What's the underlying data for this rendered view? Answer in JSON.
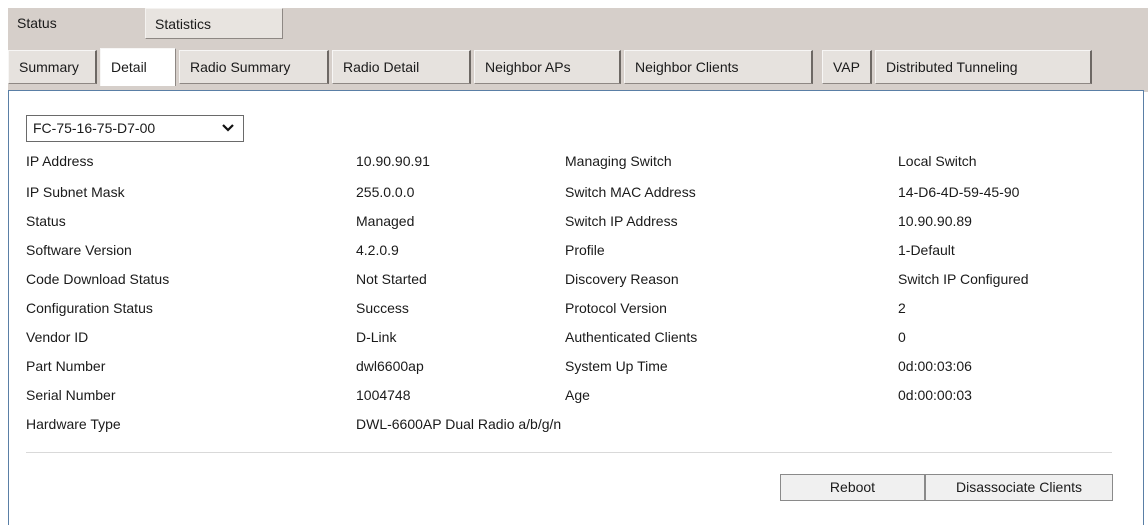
{
  "top_tabs": {
    "status": "Status",
    "statistics": "Statistics"
  },
  "sub_tabs": [
    "Summary",
    "Detail",
    "Radio Summary",
    "Radio Detail",
    "Neighbor APs",
    "Neighbor Clients",
    "VAP",
    "Distributed Tunneling"
  ],
  "ap_select": {
    "value": "FC-75-16-75-D7-00"
  },
  "details_left": [
    {
      "label": "IP Address",
      "value": "10.90.90.91"
    },
    {
      "label": "IP Subnet Mask",
      "value": "255.0.0.0"
    },
    {
      "label": "Status",
      "value": "Managed"
    },
    {
      "label": "Software Version",
      "value": "4.2.0.9"
    },
    {
      "label": "Code Download Status",
      "value": "Not Started"
    },
    {
      "label": "Configuration Status",
      "value": "Success"
    },
    {
      "label": "Vendor ID",
      "value": "D-Link"
    },
    {
      "label": "Part Number",
      "value": "dwl6600ap"
    },
    {
      "label": "Serial Number",
      "value": "1004748"
    },
    {
      "label": "Hardware Type",
      "value": "DWL-6600AP Dual Radio a/b/g/n"
    }
  ],
  "details_right": [
    {
      "label": "Managing Switch",
      "value": "Local Switch"
    },
    {
      "label": "Switch MAC Address",
      "value": "14-D6-4D-59-45-90"
    },
    {
      "label": "Switch IP Address",
      "value": "10.90.90.89"
    },
    {
      "label": "Profile",
      "value": "1-Default"
    },
    {
      "label": "Discovery Reason",
      "value": "Switch IP Configured"
    },
    {
      "label": "Protocol Version",
      "value": "2"
    },
    {
      "label": "Authenticated Clients",
      "value": "0"
    },
    {
      "label": "System Up Time",
      "value": "0d:00:03:06"
    },
    {
      "label": "Age",
      "value": "0d:00:00:03"
    }
  ],
  "buttons": {
    "reboot": "Reboot",
    "disassociate": "Disassociate Clients"
  }
}
